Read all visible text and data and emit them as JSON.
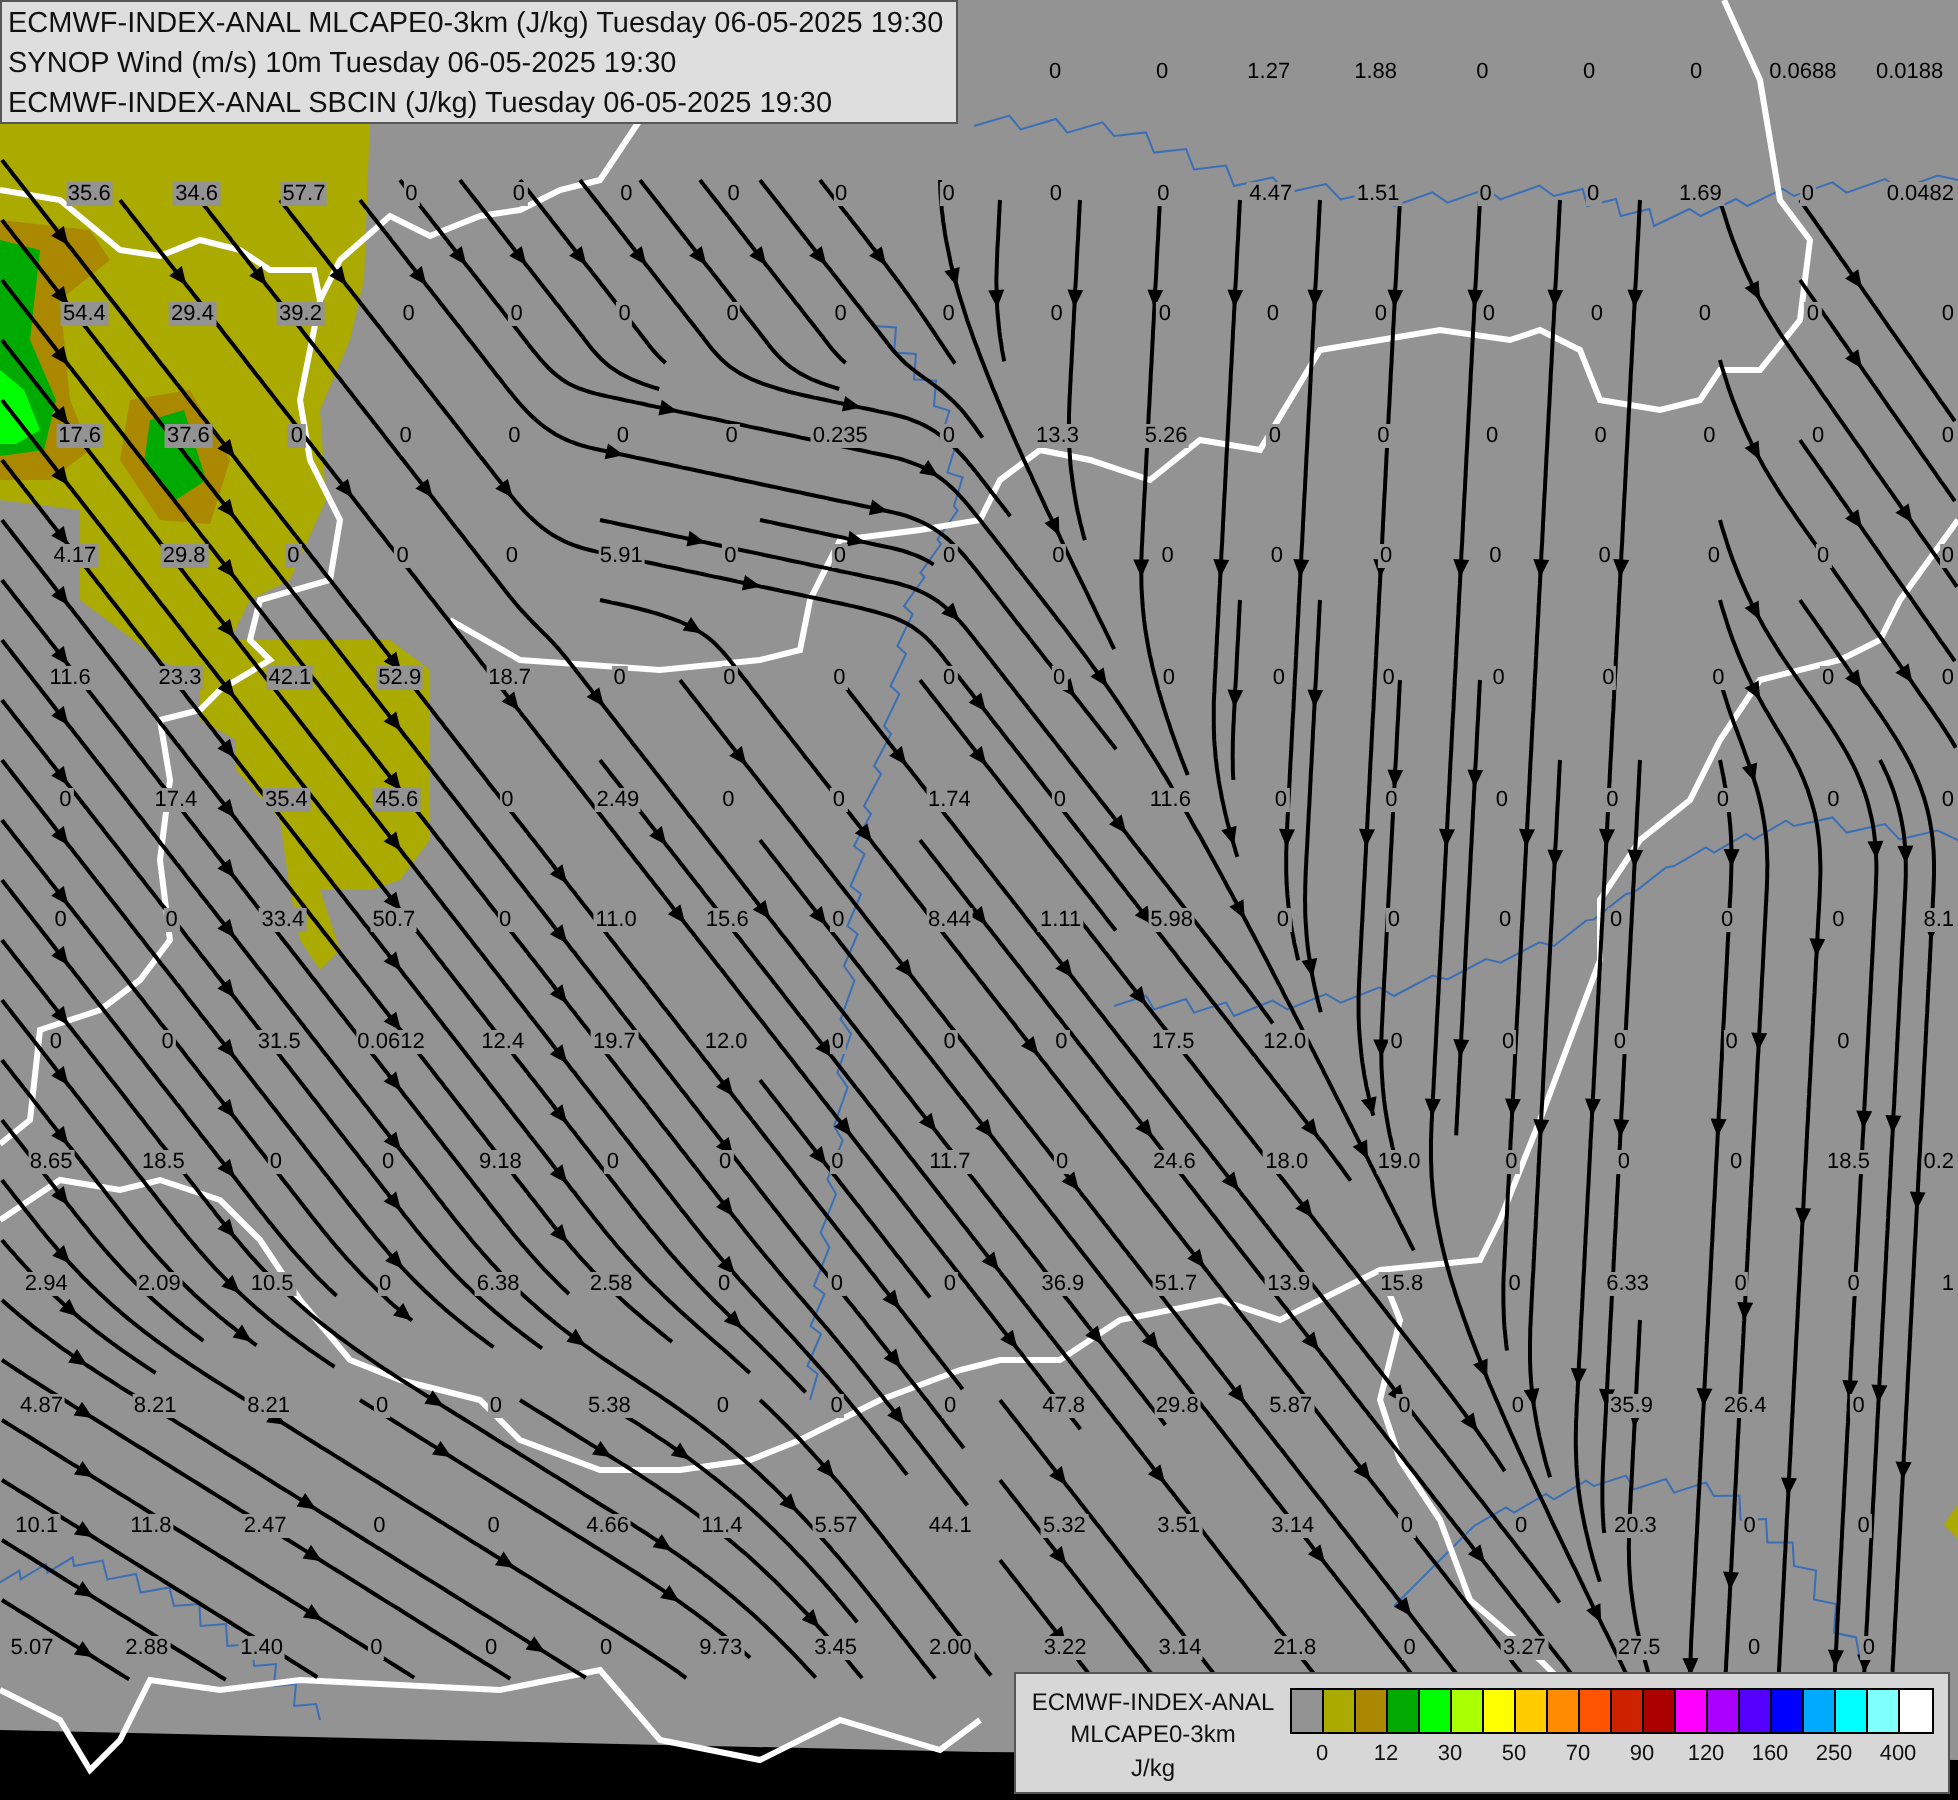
{
  "header": {
    "lines": [
      "ECMWF-INDEX-ANAL MLCAPE0-3km (J/kg) Tuesday 06-05-2025 19:30",
      "SYNOP Wind (m/s) 10m Tuesday 06-05-2025 19:30",
      "ECMWF-INDEX-ANAL SBCIN (J/kg) Tuesday 06-05-2025 19:30"
    ]
  },
  "station_rows": [
    {
      "values": [
        "0",
        "0",
        "1.27",
        "1.88",
        "0",
        "0",
        "0",
        "0.0688",
        "0.0188"
      ]
    },
    {
      "values": [
        "35.6",
        "34.6",
        "57.7",
        "0",
        "0",
        "0",
        "0",
        "0",
        "0",
        "0",
        "0",
        "4.47",
        "1.51",
        "0",
        "0",
        "1.69",
        "0",
        "0.0482"
      ]
    },
    {
      "values": [
        "54.4",
        "29.4",
        "39.2",
        "0",
        "0",
        "0",
        "0",
        "0",
        "0",
        "0",
        "0",
        "0",
        "0",
        "0",
        "0",
        "0",
        "0",
        "0"
      ]
    },
    {
      "values": [
        "17.6",
        "37.6",
        "0",
        "0",
        "0",
        "0",
        "0",
        "0.235",
        "0",
        "13.3",
        "5.26",
        "0",
        "0",
        "0",
        "0",
        "0",
        "0",
        "0"
      ]
    },
    {
      "values": [
        "4.17",
        "29.8",
        "0",
        "0",
        "0",
        "5.91",
        "0",
        "0",
        "0",
        "0",
        "0",
        "0",
        "0",
        "0",
        "0",
        "0",
        "0",
        "0"
      ]
    },
    {
      "values": [
        "11.6",
        "23.3",
        "42.1",
        "52.9",
        "18.7",
        "0",
        "0",
        "0",
        "0",
        "0",
        "0",
        "0",
        "0",
        "0",
        "0",
        "0",
        "0",
        "0"
      ]
    },
    {
      "values": [
        "0",
        "17.4",
        "35.4",
        "45.6",
        "0",
        "2.49",
        "0",
        "0",
        "1.74",
        "0",
        "11.6",
        "0",
        "0",
        "0",
        "0",
        "0",
        "0",
        "0"
      ]
    },
    {
      "values": [
        "0",
        "0",
        "33.4",
        "50.7",
        "0",
        "11.0",
        "15.6",
        "0",
        "8.44",
        "1.11",
        "5.98",
        "0",
        "0",
        "0",
        "0",
        "0",
        "0",
        "8.1"
      ]
    },
    {
      "values": [
        "0",
        "0",
        "31.5",
        "0.0612",
        "12.4",
        "19.7",
        "12.0",
        "0",
        "0",
        "0",
        "17.5",
        "12.0",
        "0",
        "0",
        "0",
        "0",
        "0"
      ]
    },
    {
      "values": [
        "8.65",
        "18.5",
        "0",
        "0",
        "9.18",
        "0",
        "0",
        "0",
        "11.7",
        "0",
        "24.6",
        "18.0",
        "19.0",
        "0",
        "0",
        "0",
        "18.5",
        "0.2"
      ]
    },
    {
      "values": [
        "2.94",
        "2.09",
        "10.5",
        "0",
        "6.38",
        "2.58",
        "0",
        "0",
        "0",
        "36.9",
        "51.7",
        "13.9",
        "15.8",
        "0",
        "6.33",
        "0",
        "0",
        "1"
      ]
    },
    {
      "values": [
        "4.87",
        "8.21",
        "8.21",
        "0",
        "0",
        "5.38",
        "0",
        "0",
        "0",
        "47.8",
        "29.8",
        "5.87",
        "0",
        "0",
        "35.9",
        "26.4",
        "0"
      ]
    },
    {
      "values": [
        "10.1",
        "11.8",
        "2.47",
        "0",
        "0",
        "4.66",
        "11.4",
        "5.57",
        "44.1",
        "5.32",
        "3.51",
        "3.14",
        "0",
        "0",
        "20.3",
        "0",
        "0"
      ]
    },
    {
      "values": [
        "5.07",
        "2.88",
        "1.40",
        "0",
        "0",
        "0",
        "9.73",
        "3.45",
        "2.00",
        "3.22",
        "3.14",
        "21.8",
        "0",
        "3.27",
        "27.5",
        "0",
        "0"
      ]
    }
  ],
  "legend": {
    "lines": [
      "ECMWF-INDEX-ANAL",
      "MLCAPE0-3km"
    ],
    "unit": "J/kg",
    "swatches": [
      {
        "color": "#939393"
      },
      {
        "color": "#aaaa00"
      },
      {
        "color": "#aa8800"
      },
      {
        "color": "#00aa00"
      },
      {
        "color": "#00ff00"
      },
      {
        "color": "#aaff00"
      },
      {
        "color": "#ffff00"
      },
      {
        "color": "#ffcc00"
      },
      {
        "color": "#ff8c00"
      },
      {
        "color": "#ff5500"
      },
      {
        "color": "#cc2200"
      },
      {
        "color": "#aa0000"
      },
      {
        "color": "#ff00ff"
      },
      {
        "color": "#aa00ff"
      },
      {
        "color": "#5500ff"
      },
      {
        "color": "#0000ff"
      },
      {
        "color": "#00aaff"
      },
      {
        "color": "#00ffff"
      },
      {
        "color": "#80ffff"
      },
      {
        "color": "#ffffff"
      }
    ],
    "ticks": [
      "0",
      "12",
      "30",
      "50",
      "70",
      "90",
      "120",
      "160",
      "250",
      "400"
    ]
  }
}
